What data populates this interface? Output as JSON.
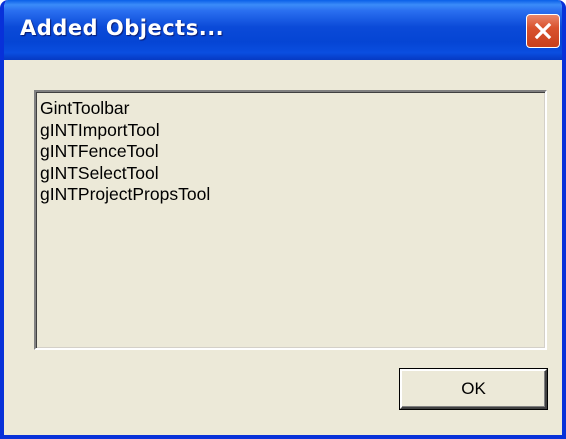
{
  "dialog": {
    "title": "Added Objects...",
    "close_icon": "close-icon",
    "items": [
      "GintToolbar",
      "gINTImportTool",
      "gINTFenceTool",
      "gINTSelectTool",
      "gINTProjectPropsTool"
    ],
    "ok_label": "OK"
  },
  "colors": {
    "title_bar": "#0545d4",
    "window_frame": "#0831d9",
    "dialog_background": "#ece9d8",
    "close_button": "#d9532e"
  }
}
